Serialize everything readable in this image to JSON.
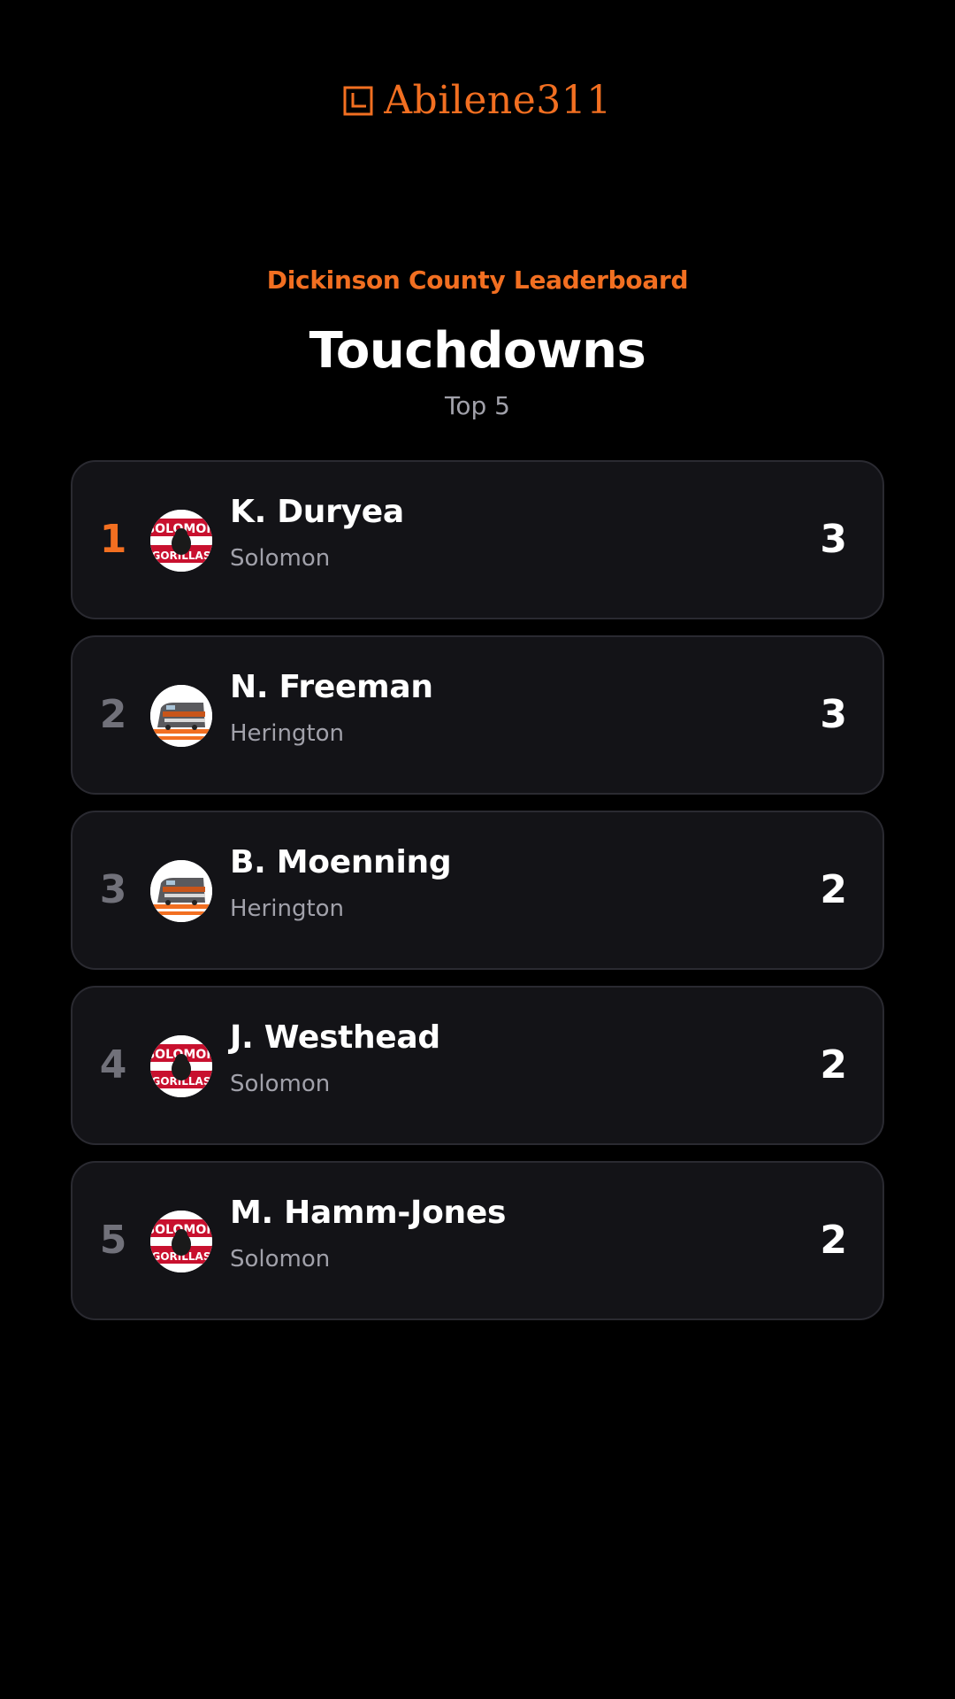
{
  "brand": {
    "name": "Abilene311",
    "accent": "#f26f21"
  },
  "header": {
    "eyebrow": "Dickinson County Leaderboard",
    "title": "Touchdowns",
    "subtitle": "Top 5"
  },
  "leaders": [
    {
      "rank": "1",
      "name": "K. Duryea",
      "team": "Solomon",
      "value": "3",
      "logo": "solomon-gorillas-logo"
    },
    {
      "rank": "2",
      "name": "N. Freeman",
      "team": "Herington",
      "value": "3",
      "logo": "herington-train-logo"
    },
    {
      "rank": "3",
      "name": "B. Moenning",
      "team": "Herington",
      "value": "2",
      "logo": "herington-train-logo"
    },
    {
      "rank": "4",
      "name": "J. Westhead",
      "team": "Solomon",
      "value": "2",
      "logo": "solomon-gorillas-logo"
    },
    {
      "rank": "5",
      "name": "M. Hamm-Jones",
      "team": "Solomon",
      "value": "2",
      "logo": "solomon-gorillas-logo"
    }
  ],
  "colors": {
    "background": "#000000",
    "card": "#131317",
    "card_border": "#2a2a31",
    "muted_text": "#a1a1aa",
    "rank_muted": "#71717a"
  }
}
